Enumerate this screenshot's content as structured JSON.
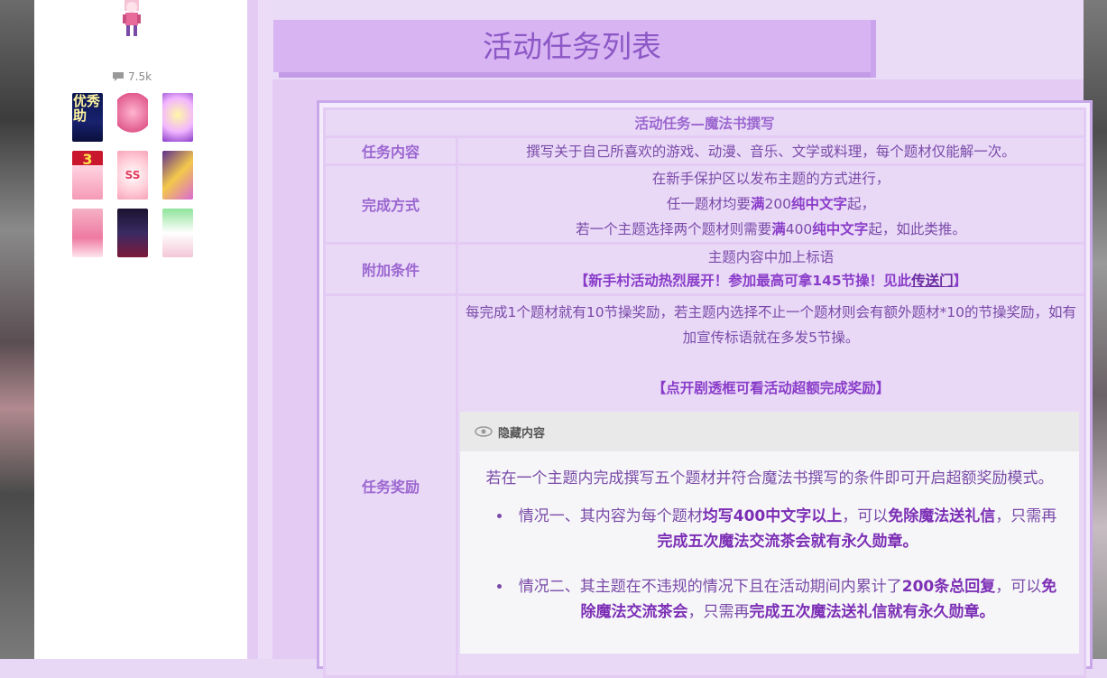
{
  "sidebar": {
    "view_count": "7.5k",
    "medals": [
      {
        "name": "medal-youxiu-zhu",
        "text": "优秀助"
      },
      {
        "name": "medal-pink-hair-girl",
        "text": ""
      },
      {
        "name": "medal-blonde-star-girl",
        "text": ""
      },
      {
        "name": "medal-rank-3",
        "text": "3"
      },
      {
        "name": "medal-ss",
        "text": "SS"
      },
      {
        "name": "medal-purple-gold",
        "text": ""
      },
      {
        "name": "medal-pink-twin",
        "text": ""
      },
      {
        "name": "medal-dark-figure",
        "text": ""
      },
      {
        "name": "medal-cat-ear-girl",
        "text": ""
      }
    ]
  },
  "page": {
    "title": "活动任务列表"
  },
  "table": {
    "header": "活动任务—魔法书撰写",
    "rows": {
      "content": {
        "label": "任务内容",
        "text": "撰写关于自己所喜欢的游戏、动漫、音乐、文学或料理，每个题材仅能解一次。"
      },
      "method": {
        "label": "完成方式",
        "line1": "在新手保护区以发布主题的方式进行，",
        "line2_pre": "任一题材均要",
        "line2_b1": "满",
        "line2_mid": "200",
        "line2_b2": "纯中文字",
        "line2_post": "起，",
        "line3_pre": "若一个主题选择两个题材则需要",
        "line3_b1": "满",
        "line3_mid": "400",
        "line3_b2": "纯中文字",
        "line3_post": "起，如此类推。"
      },
      "extra": {
        "label": "附加条件",
        "line1": "主题内容中加上标语",
        "slogan": "【新手村活动热烈展开！参加最高可拿145节操！见此",
        "link": "传送门",
        "slogan_end": "】"
      },
      "reward": {
        "label": "任务奖励",
        "text": "每完成1个题材就有10节操奖励，若主题内选择不止一个题材则会有额外题材*10的节操奖励，如有加宣传标语就在多发5节操。",
        "spoiler_hint": "【点开剧透框可看活动超额完成奖励】",
        "spoiler_title": "隐藏内容",
        "spoiler_intro": "若在一个主题内完成撰写五个题材并符合魔法书撰写的条件即可开启超额奖励模式。",
        "case1_pre": "情况一、其内容为每个题材",
        "case1_b1": "均写400中文字以上",
        "case1_mid": "，可以",
        "case1_b2": "免除魔法送礼信",
        "case1_mid2": "，只需再",
        "case1_b3": "完成五次魔法交流茶会就有永久勋章。",
        "case2_pre": "情况二、其主题在不违规的情况下且在活动期间内累计了",
        "case2_b1": "200条总回复",
        "case2_mid": "，可以",
        "case2_b2": "免除魔法交流茶会",
        "case2_mid2": "，只需再",
        "case2_b3": "完成五次魔法送礼信就有永久勋章。"
      }
    }
  },
  "colors": {
    "accent": "#8a3cc9",
    "banner": "#d8b4f3",
    "cell_bg": "#e9d9f7"
  }
}
